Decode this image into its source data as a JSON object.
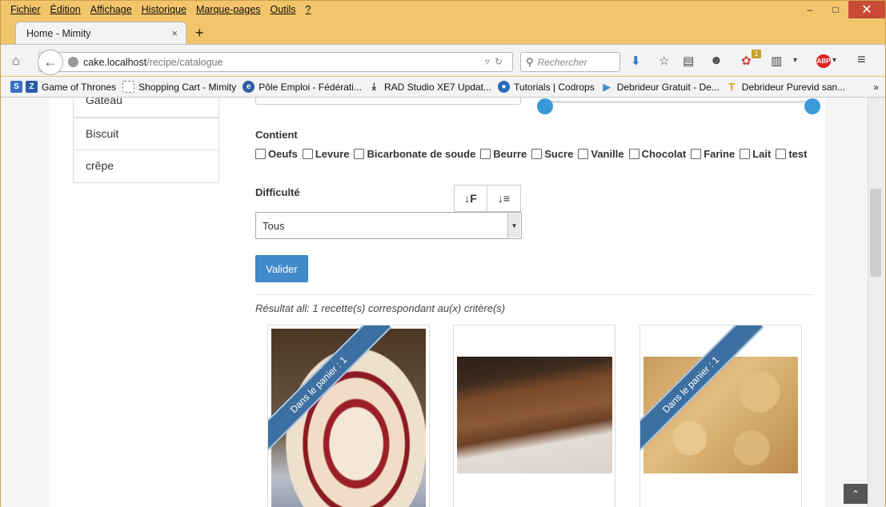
{
  "menubar": {
    "items": [
      "Fichier",
      "Édition",
      "Affichage",
      "Historique",
      "Marque-pages",
      "Outils",
      "?"
    ]
  },
  "window_controls": {
    "minimize": "‒",
    "maximize": "□",
    "close": "✕"
  },
  "tab": {
    "title": "Home - Mimity",
    "close": "×",
    "new_tab": "+"
  },
  "navbar": {
    "url_host": "cake.localhost",
    "url_path": "/recipe/catalogue",
    "search_placeholder": "Rechercher",
    "badge_count": "1"
  },
  "bookmarks": [
    {
      "label": "Game of Thrones",
      "icon": "zeta-icon"
    },
    {
      "label": "Shopping Cart - Mimity",
      "icon": "blank-page-icon"
    },
    {
      "label": "Pôle Emploi - Fédérati...",
      "icon": "pole-emploi-icon"
    },
    {
      "label": "RAD Studio XE7 Updat...",
      "icon": "download-icon"
    },
    {
      "label": "Tutorials | Codrops",
      "icon": "codrops-icon"
    },
    {
      "label": "Debrideur Gratuit - De...",
      "icon": "play-icon"
    },
    {
      "label": "Debrideur Purevid san...",
      "icon": "t-icon"
    }
  ],
  "bookmarks_more": "»",
  "sidebar": {
    "categories": [
      "Gateau",
      "Biscuit",
      "crêpe"
    ]
  },
  "filters": {
    "contient_label": "Contient",
    "ingredients": [
      "Oeufs",
      "Levure",
      "Bicarbonate de soude",
      "Beurre",
      "Sucre",
      "Vanille",
      "Chocolat",
      "Farine",
      "Lait",
      "test"
    ],
    "difficulte_label": "Difficulté",
    "difficulte_value": "Tous",
    "sort_asc": "↓F",
    "sort_desc": "↓≡",
    "submit_label": "Valider"
  },
  "results": {
    "summary": "Résultat all: 1 recette(s) correspondant au(x) critère(s)",
    "cards": [
      {
        "ribbon": "Dans le panier : 1",
        "image": "swiss-roll-cake",
        "bg": "#4a3a2a"
      },
      {
        "ribbon": "",
        "image": "chocolate-cake-slice",
        "bg": "#3a2a1c"
      },
      {
        "ribbon": "Dans le panier : 1",
        "image": "butter-biscuits",
        "bg": "#c9a15f"
      }
    ]
  },
  "scroll_to_top": "⌃"
}
